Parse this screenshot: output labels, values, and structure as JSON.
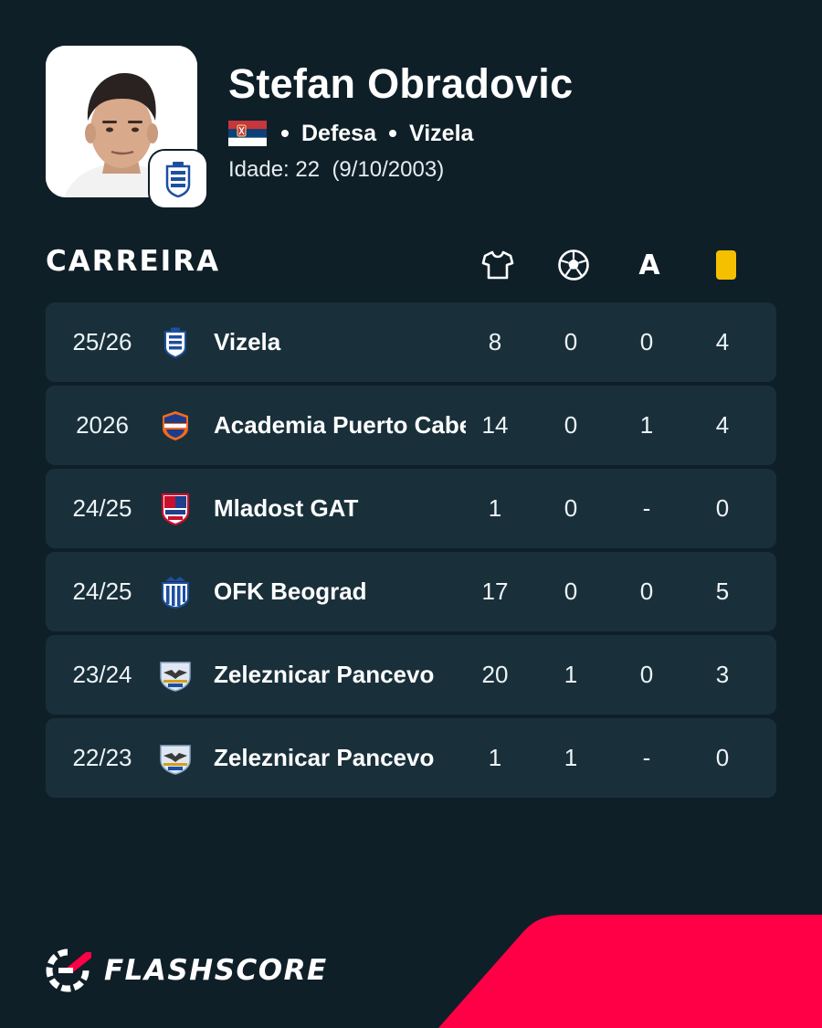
{
  "player": {
    "name": "Stefan Obradovic",
    "position": "Defesa",
    "club": "Vizela",
    "age_label": "Idade: 22",
    "birth_date": "(9/10/2003)",
    "nationality_flag": "serbia-flag-icon"
  },
  "career": {
    "title": "CARREIRA",
    "columns": [
      {
        "key": "apps",
        "icon": "shirt-icon"
      },
      {
        "key": "goals",
        "icon": "football-icon"
      },
      {
        "key": "assists",
        "label": "A"
      },
      {
        "key": "yellow_cards",
        "icon": "yellow-card-icon",
        "color": "#f5c000"
      }
    ],
    "rows": [
      {
        "season": "25/26",
        "club": "Vizela",
        "apps": "8",
        "goals": "0",
        "assists": "0",
        "cards": "4",
        "logo": "vizela-logo"
      },
      {
        "season": "2026",
        "club": "Academia Puerto Cabello",
        "apps": "14",
        "goals": "0",
        "assists": "1",
        "cards": "4",
        "logo": "academia-puerto-cabello-logo"
      },
      {
        "season": "24/25",
        "club": "Mladost GAT",
        "apps": "1",
        "goals": "0",
        "assists": "-",
        "cards": "0",
        "logo": "mladost-gat-logo"
      },
      {
        "season": "24/25",
        "club": "OFK Beograd",
        "apps": "17",
        "goals": "0",
        "assists": "0",
        "cards": "5",
        "logo": "ofk-beograd-logo"
      },
      {
        "season": "23/24",
        "club": "Zeleznicar Pancevo",
        "apps": "20",
        "goals": "1",
        "assists": "0",
        "cards": "3",
        "logo": "zeleznicar-pancevo-logo"
      },
      {
        "season": "22/23",
        "club": "Zeleznicar Pancevo",
        "apps": "1",
        "goals": "1",
        "assists": "-",
        "cards": "0",
        "logo": "zeleznicar-pancevo-logo"
      }
    ]
  },
  "footer": {
    "brand": "FLASHSCORE",
    "accent_color": "#ff0046"
  },
  "colors": {
    "background": "#0f1f28",
    "row_background": "#19303b",
    "yellow_card": "#f5c000"
  }
}
